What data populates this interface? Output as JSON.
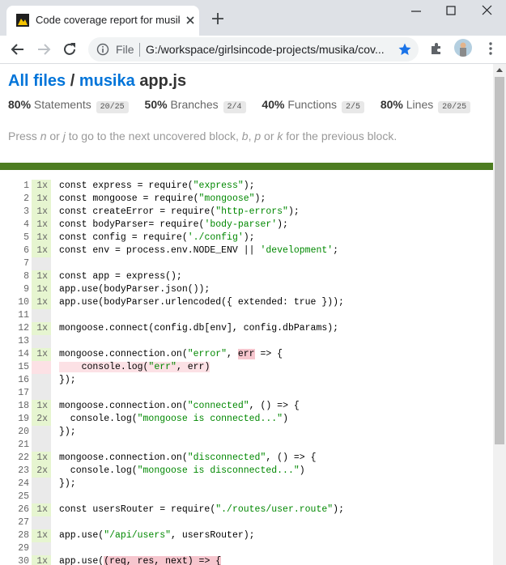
{
  "browser": {
    "tab_title": "Code coverage report for musika",
    "url_scheme_label": "File",
    "url": "G:/workspace/girlsincode-projects/musika/cov..."
  },
  "header": {
    "all_files": "All files",
    "separator": " / ",
    "folder": "musika",
    "file": "app.js"
  },
  "summary": [
    {
      "pct": "80%",
      "label": "Statements",
      "fraction": "20/25"
    },
    {
      "pct": "50%",
      "label": "Branches",
      "fraction": "2/4"
    },
    {
      "pct": "40%",
      "label": "Functions",
      "fraction": "2/5"
    },
    {
      "pct": "80%",
      "label": "Lines",
      "fraction": "20/25"
    }
  ],
  "hint": {
    "t1": "Press ",
    "k1": "n",
    "t2": " or ",
    "k2": "j",
    "t3": " to go to the next uncovered block, ",
    "k3": "b",
    "t4": ", ",
    "k4": "p",
    "t5": " or ",
    "k5": "k",
    "t6": " for the previous block."
  },
  "code": [
    {
      "n": "1",
      "c": "1x",
      "t": "yes",
      "parts": [
        [
          "const express = require(",
          ""
        ],
        [
          "\"express\"",
          "s"
        ],
        [
          ");",
          ""
        ]
      ]
    },
    {
      "n": "2",
      "c": "1x",
      "t": "yes",
      "parts": [
        [
          "const mongoose = require(",
          ""
        ],
        [
          "\"mongoose\"",
          "s"
        ],
        [
          ");",
          ""
        ]
      ]
    },
    {
      "n": "3",
      "c": "1x",
      "t": "yes",
      "parts": [
        [
          "const createError = require(",
          ""
        ],
        [
          "\"http-errors\"",
          "s"
        ],
        [
          ");",
          ""
        ]
      ]
    },
    {
      "n": "4",
      "c": "1x",
      "t": "yes",
      "parts": [
        [
          "const bodyParser= require(",
          ""
        ],
        [
          "'body-parser'",
          "s"
        ],
        [
          ");",
          ""
        ]
      ]
    },
    {
      "n": "5",
      "c": "1x",
      "t": "yes",
      "parts": [
        [
          "const config = require(",
          ""
        ],
        [
          "'./config'",
          "s"
        ],
        [
          ");",
          ""
        ]
      ]
    },
    {
      "n": "6",
      "c": "1x",
      "t": "yes",
      "parts": [
        [
          "const env = process.env.NODE_ENV || ",
          ""
        ],
        [
          "'development'",
          "s"
        ],
        [
          ";",
          ""
        ]
      ]
    },
    {
      "n": "7",
      "c": "",
      "t": "neutral",
      "parts": []
    },
    {
      "n": "8",
      "c": "1x",
      "t": "yes",
      "parts": [
        [
          "const app = express();",
          ""
        ]
      ]
    },
    {
      "n": "9",
      "c": "1x",
      "t": "yes",
      "parts": [
        [
          "app.use(bodyParser.json());",
          ""
        ]
      ]
    },
    {
      "n": "10",
      "c": "1x",
      "t": "yes",
      "parts": [
        [
          "app.use(bodyParser.urlencoded({ extended: true }));",
          ""
        ]
      ]
    },
    {
      "n": "11",
      "c": "",
      "t": "neutral",
      "parts": []
    },
    {
      "n": "12",
      "c": "1x",
      "t": "yes",
      "parts": [
        [
          "mongoose.connect(config.db[env], config.dbParams);",
          ""
        ]
      ]
    },
    {
      "n": "13",
      "c": "",
      "t": "neutral",
      "parts": []
    },
    {
      "n": "14",
      "c": "1x",
      "t": "yes",
      "parts": [
        [
          "mongoose.connection.on(",
          ""
        ],
        [
          "\"error\"",
          "s"
        ],
        [
          ", ",
          ""
        ],
        [
          "err",
          "hl-tok"
        ],
        [
          " => {",
          ""
        ]
      ]
    },
    {
      "n": "15",
      "c": "",
      "t": "no",
      "parts": [
        [
          "    console.log(",
          "hl"
        ],
        [
          "\"err\"",
          "s hl"
        ],
        [
          ", err)",
          "hl"
        ]
      ]
    },
    {
      "n": "16",
      "c": "",
      "t": "neutral",
      "parts": [
        [
          "});",
          ""
        ]
      ]
    },
    {
      "n": "17",
      "c": "",
      "t": "neutral",
      "parts": []
    },
    {
      "n": "18",
      "c": "1x",
      "t": "yes",
      "parts": [
        [
          "mongoose.connection.on(",
          ""
        ],
        [
          "\"connected\"",
          "s"
        ],
        [
          ", () => {",
          ""
        ]
      ]
    },
    {
      "n": "19",
      "c": "2x",
      "t": "yes",
      "parts": [
        [
          "  console.log(",
          ""
        ],
        [
          "\"mongoose is connected...\"",
          "s"
        ],
        [
          ")",
          ""
        ]
      ]
    },
    {
      "n": "20",
      "c": "",
      "t": "neutral",
      "parts": [
        [
          "});",
          ""
        ]
      ]
    },
    {
      "n": "21",
      "c": "",
      "t": "neutral",
      "parts": []
    },
    {
      "n": "22",
      "c": "1x",
      "t": "yes",
      "parts": [
        [
          "mongoose.connection.on(",
          ""
        ],
        [
          "\"disconnected\"",
          "s"
        ],
        [
          ", () => {",
          ""
        ]
      ]
    },
    {
      "n": "23",
      "c": "2x",
      "t": "yes",
      "parts": [
        [
          "  console.log(",
          ""
        ],
        [
          "\"mongoose is disconnected...\"",
          "s"
        ],
        [
          ")",
          ""
        ]
      ]
    },
    {
      "n": "24",
      "c": "",
      "t": "neutral",
      "parts": [
        [
          "});",
          ""
        ]
      ]
    },
    {
      "n": "25",
      "c": "",
      "t": "neutral",
      "parts": []
    },
    {
      "n": "26",
      "c": "1x",
      "t": "yes",
      "parts": [
        [
          "const usersRouter = require(",
          ""
        ],
        [
          "\"./routes/user.route\"",
          "s"
        ],
        [
          ");",
          ""
        ]
      ]
    },
    {
      "n": "27",
      "c": "",
      "t": "neutral",
      "parts": []
    },
    {
      "n": "28",
      "c": "1x",
      "t": "yes",
      "parts": [
        [
          "app.use(",
          ""
        ],
        [
          "\"/api/users\"",
          "s"
        ],
        [
          ", usersRouter);",
          ""
        ]
      ]
    },
    {
      "n": "29",
      "c": "",
      "t": "neutral",
      "parts": []
    },
    {
      "n": "30",
      "c": "1x",
      "t": "yes",
      "parts": [
        [
          "app.use(",
          ""
        ],
        [
          "(req, res, next) => {",
          "hl-tok"
        ]
      ]
    }
  ],
  "colors": {
    "covered": "#e6f5d0",
    "uncovered": "#fce1e5",
    "status_bar": "#4d7d21",
    "link": "#0074d9"
  }
}
